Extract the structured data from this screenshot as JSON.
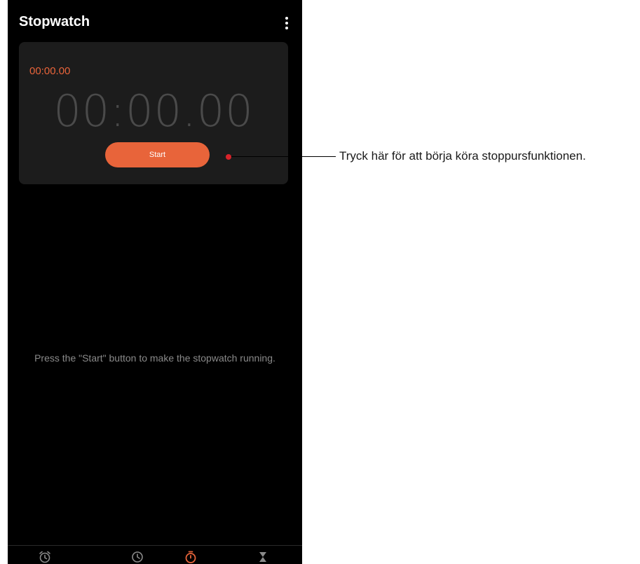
{
  "app": {
    "title": "Stopwatch",
    "menu_icon": "more-vert-icon"
  },
  "stopwatch": {
    "lap_time": "00:00.00",
    "main_time": "00:00.00",
    "start_label": "Start"
  },
  "hint_text": "Press the \"Start\" button to make the stopwatch running.",
  "bottom_nav": {
    "items": [
      {
        "icon": "alarm-icon",
        "active": false
      },
      {
        "icon": "clock-icon",
        "active": false
      },
      {
        "icon": "stopwatch-icon",
        "active": true
      },
      {
        "icon": "timer-icon",
        "active": false
      }
    ]
  },
  "annotation": {
    "text": "Tryck här för att börja köra stoppursfunktionen."
  },
  "colors": {
    "accent": "#e8643a",
    "background": "#000000",
    "card": "#1c1c1c",
    "callout_dot": "#d8232a"
  }
}
